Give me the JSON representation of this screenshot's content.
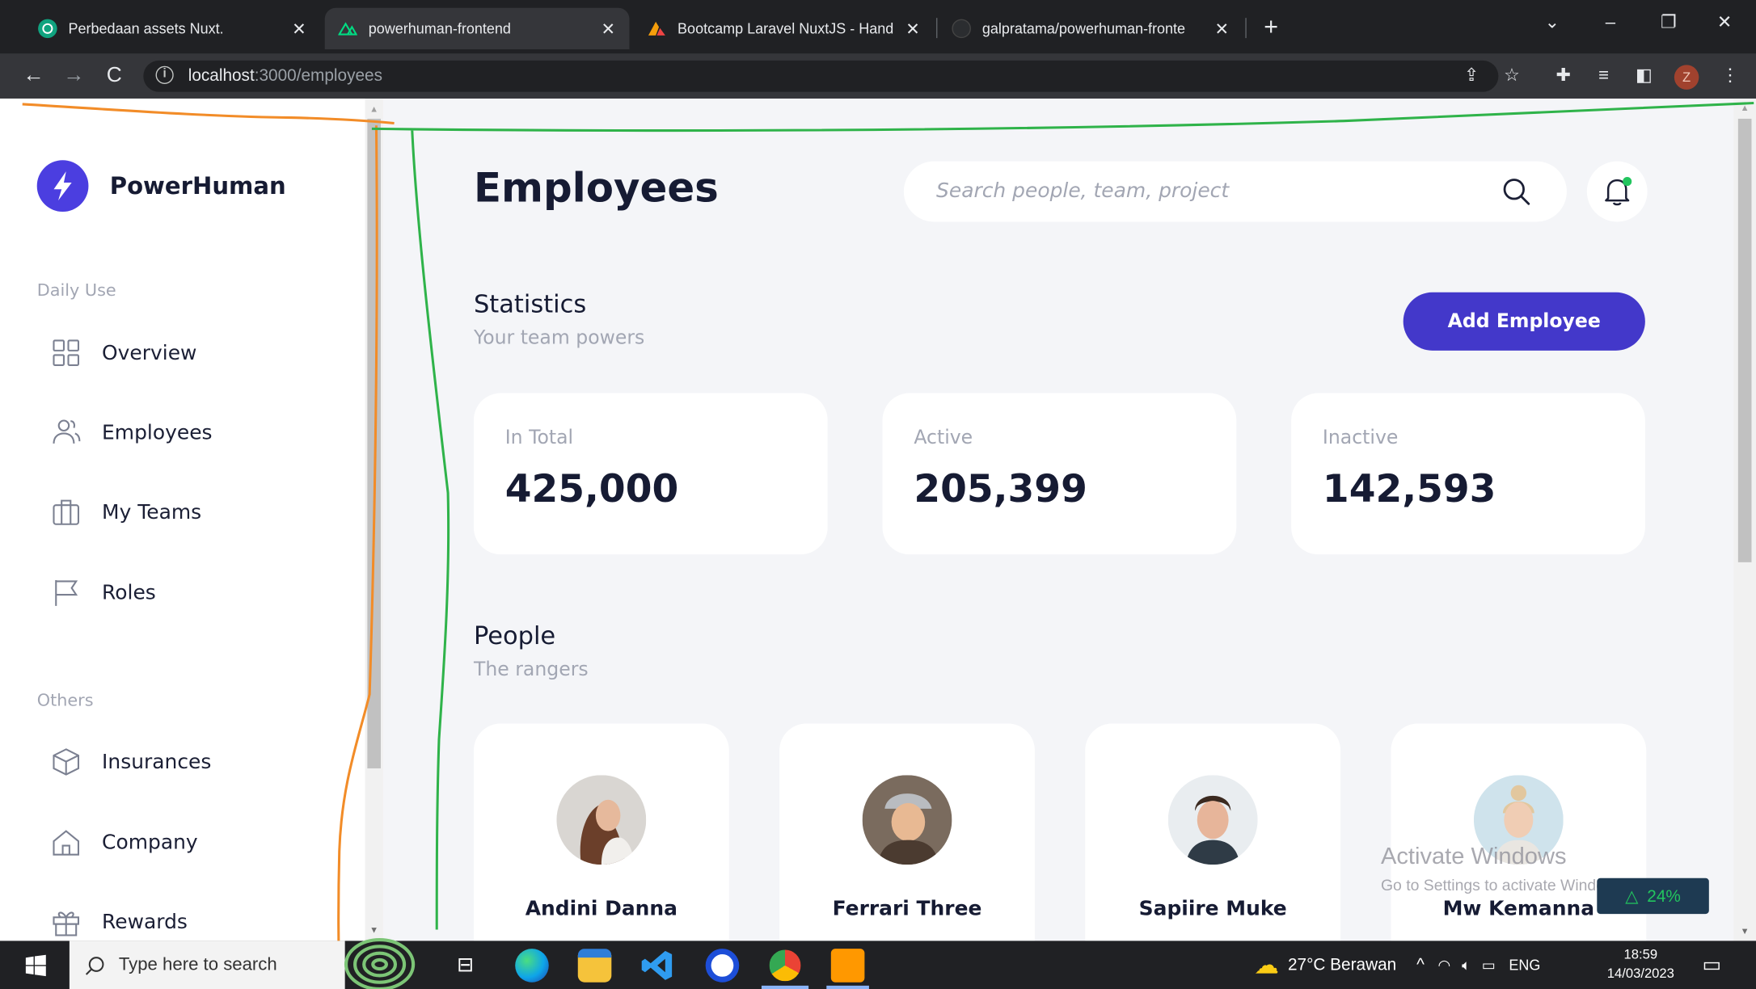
{
  "browser": {
    "tabs": [
      {
        "title": "Perbedaan assets Nuxt.",
        "icon": "openai-icon",
        "active": false
      },
      {
        "title": "powerhuman-frontend",
        "icon": "nuxt-icon",
        "active": true
      },
      {
        "title": "Bootcamp Laravel NuxtJS - Hand",
        "icon": "buildwithangga-icon",
        "active": false
      },
      {
        "title": "galpratama/powerhuman-fronte",
        "icon": "github-icon",
        "active": false
      }
    ],
    "url_host": "localhost",
    "url_path": ":3000/employees",
    "profile_initial": "Z"
  },
  "sidebar": {
    "brand": "PowerHuman",
    "sections": [
      {
        "title": "Daily Use",
        "items": [
          {
            "label": "Overview",
            "icon": "grid-icon"
          },
          {
            "label": "Employees",
            "icon": "users-icon"
          },
          {
            "label": "My Teams",
            "icon": "teams-icon"
          },
          {
            "label": "Roles",
            "icon": "flag-icon"
          }
        ]
      },
      {
        "title": "Others",
        "items": [
          {
            "label": "Insurances",
            "icon": "box-icon"
          },
          {
            "label": "Company",
            "icon": "home-icon"
          },
          {
            "label": "Rewards",
            "icon": "gift-icon"
          }
        ]
      }
    ]
  },
  "main": {
    "title": "Employees",
    "search_placeholder": "Search people, team, project",
    "statistics": {
      "title": "Statistics",
      "subtitle": "Your team powers",
      "add_button": "Add Employee",
      "cards": [
        {
          "label": "In Total",
          "value": "425,000"
        },
        {
          "label": "Active",
          "value": "205,399"
        },
        {
          "label": "Inactive",
          "value": "142,593"
        }
      ]
    },
    "people": {
      "title": "People",
      "subtitle": "The rangers",
      "cards": [
        {
          "name": "Andini Danna",
          "role": ""
        },
        {
          "name": "Ferrari Three",
          "role": ""
        },
        {
          "name": "Sapiire Muke",
          "role": ""
        },
        {
          "name": "Mw Kemanna",
          "role": ""
        }
      ]
    }
  },
  "overlay": {
    "activation_title": "Activate Windows",
    "activation_subtitle": "Go to Settings to activate Windows.",
    "net_widget": "24%"
  },
  "taskbar": {
    "search_placeholder": "Type here to search",
    "weather": "27°C  Berawan",
    "language": "ENG",
    "time": "18:59",
    "date": "14/03/2023"
  },
  "colors": {
    "accent": "#4338ca",
    "logo": "#4b3ee0",
    "page_bg": "#f4f5f8",
    "annotation_orange": "#f28c28",
    "annotation_green": "#2fb34a"
  }
}
